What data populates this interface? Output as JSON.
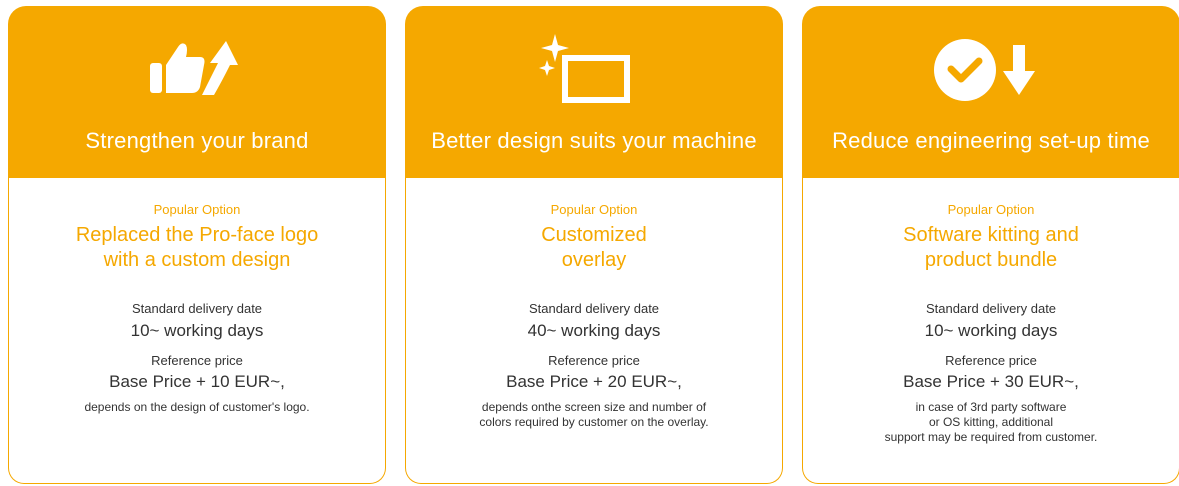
{
  "colors": {
    "accent": "#f5a800",
    "header_text": "#ffffff",
    "body_text": "#333333"
  },
  "cards": [
    {
      "icon": "thumbs-up-arrow-icon",
      "title": "Strengthen your brand",
      "badge": "Popular Option",
      "option_name": "Replaced the Pro-face logo\nwith a custom design",
      "delivery_label": "Standard delivery date",
      "delivery_value": "10~ working days",
      "price_label": "Reference price",
      "price_value": "Base Price + 10 EUR~,",
      "note": "depends on the design of customer's logo."
    },
    {
      "icon": "sparkle-screen-icon",
      "title": "Better design suits your machine",
      "badge": "Popular Option",
      "option_name": "Customized\noverlay",
      "delivery_label": "Standard delivery date",
      "delivery_value": "40~ working days",
      "price_label": "Reference price",
      "price_value": "Base Price + 20 EUR~,",
      "note": "depends onthe screen size and  number of\ncolors required by customer on the overlay."
    },
    {
      "icon": "check-down-arrow-icon",
      "title": "Reduce engineering set-up time",
      "badge": "Popular Option",
      "option_name": "Software kitting and\nproduct bundle",
      "delivery_label": "Standard delivery date",
      "delivery_value": "10~ working days",
      "price_label": "Reference price",
      "price_value": "Base Price + 30 EUR~,",
      "note": "in case of 3rd party software\nor OS kitting, additional\nsupport may be required from customer."
    }
  ]
}
